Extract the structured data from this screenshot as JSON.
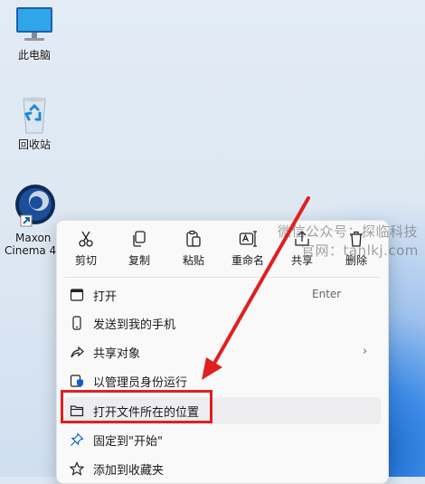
{
  "desktop": {
    "icons": [
      {
        "name": "此电脑"
      },
      {
        "name": "回收站"
      },
      {
        "name_line1": "Maxon",
        "name_line2": "Cinema 4"
      }
    ]
  },
  "toolbar": {
    "cut": "剪切",
    "copy": "复制",
    "paste": "粘贴",
    "rename": "重命名",
    "share": "共享",
    "delete": "删除"
  },
  "menu": {
    "items": [
      {
        "label": "打开",
        "shortcut": "Enter"
      },
      {
        "label": "发送到我的手机"
      },
      {
        "label": "共享对象",
        "submenu": "›"
      },
      {
        "label": "以管理员身份运行"
      },
      {
        "label": "打开文件所在的位置"
      },
      {
        "label": "固定到\"开始\""
      },
      {
        "label": "添加到收藏夹"
      }
    ]
  },
  "watermark": {
    "line1": "微信公众号：探临科技",
    "line2": "官网：tanlkj.com"
  },
  "colors": {
    "annotation_red": "#e02020",
    "accent_blue": "#0a64c8"
  }
}
